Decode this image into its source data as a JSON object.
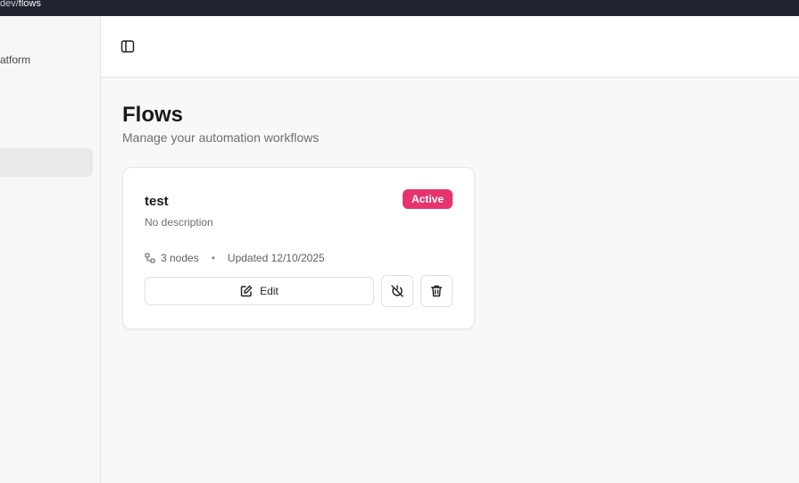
{
  "browser": {
    "url_prefix": "dev/",
    "url_path": "flows"
  },
  "sidebar": {
    "brand_fragment": "atform"
  },
  "page": {
    "title": "Flows",
    "subtitle": "Manage your automation workflows"
  },
  "flows": [
    {
      "name": "test",
      "status": "Active",
      "description": "No description",
      "nodes": "3 nodes",
      "separator": "•",
      "updated": "Updated 12/10/2025",
      "edit_label": "Edit"
    }
  ],
  "colors": {
    "status_active": "#e8336f",
    "url_bar": "#202430"
  },
  "icons": {
    "sidebar_toggle": "panel-left-icon",
    "nodes": "workflow-icon",
    "edit": "edit-icon",
    "deactivate": "power-off-icon",
    "delete": "trash-icon"
  }
}
